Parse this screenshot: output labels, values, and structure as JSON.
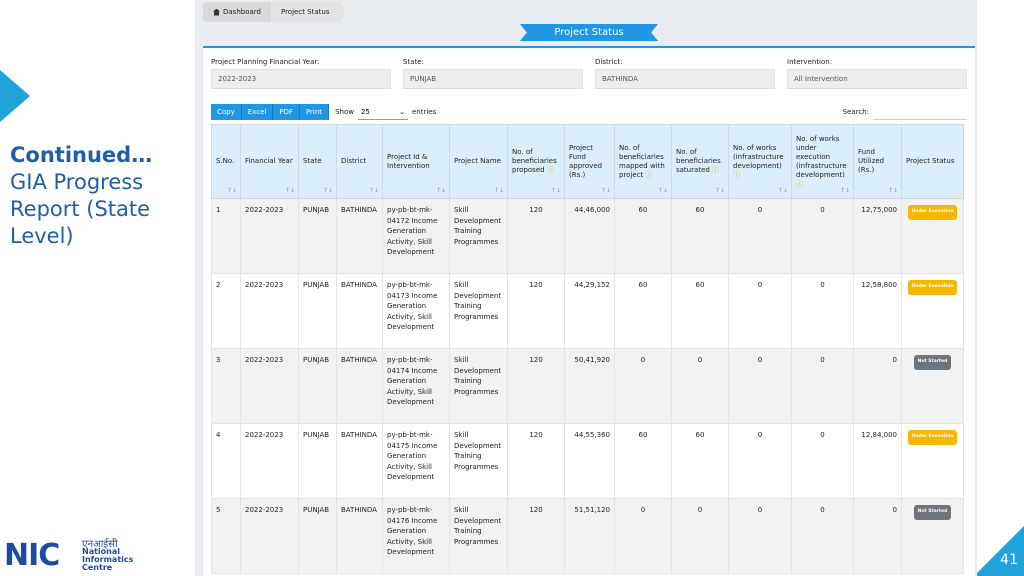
{
  "slide": {
    "title_bold": "Continued…",
    "title_rest": "GIA Progress Report (State Level)",
    "page_number": "41",
    "logo": {
      "mark": "NIC",
      "hindi": "एनआईसी",
      "line1": "National",
      "line2": "Informatics",
      "line3": "Centre"
    }
  },
  "breadcrumb": {
    "home": "Dashboard",
    "current": "Project Status"
  },
  "ribbon_title": "Project Status",
  "filters": [
    {
      "label": "Project Planning Financial Year:",
      "value": "2022-2023"
    },
    {
      "label": "State:",
      "value": "PUNJAB"
    },
    {
      "label": "District:",
      "value": "BATHINDA"
    },
    {
      "label": "Intervention:",
      "value": "All Intervention"
    }
  ],
  "toolbar": {
    "buttons": [
      "Copy",
      "Excel",
      "PDF",
      "Print"
    ],
    "show_label": "Show",
    "show_value": "25",
    "entries_label": "entries",
    "search_label": "Search:"
  },
  "colors": {
    "accent": "#2196e3",
    "under_execution": "#f5b700",
    "not_started": "#6c757d",
    "link": "#1a3fb5"
  },
  "table": {
    "headers": [
      "S.No.",
      "Financial Year",
      "State",
      "District",
      "Project Id & Intervention",
      "Project Name",
      "No. of beneficiaries proposed",
      "Project Fund approved (Rs.)",
      "No. of beneficiaries mapped with project",
      "No. of beneficiaries saturated",
      "No. of works (infrastructure development)",
      "No. of works under execution (infrastructure development)",
      "Fund Utilized (Rs.)",
      "Project Status"
    ],
    "rows": [
      {
        "sno": "1",
        "year": "2022-2023",
        "state": "PUNJAB",
        "district": "BATHINDA",
        "project_id": "py-pb-bt-mk-04172 Income Generation Activity, Skill Development",
        "name": "Skill Development Training Programmes",
        "proposed": "120",
        "fund": "44,46,000",
        "mapped": "60",
        "saturated": "60",
        "works": "0",
        "works_exec": "0",
        "utilized": "12,75,000",
        "status": "Under Execution",
        "status_type": "under"
      },
      {
        "sno": "2",
        "year": "2022-2023",
        "state": "PUNJAB",
        "district": "BATHINDA",
        "project_id": "py-pb-bt-mk-04173 Income Generation Activity, Skill Development",
        "name": "Skill Development Training Programmes",
        "proposed": "120",
        "fund": "44,29,152",
        "mapped": "60",
        "saturated": "60",
        "works": "0",
        "works_exec": "0",
        "utilized": "12,58,800",
        "status": "Under Execution",
        "status_type": "under"
      },
      {
        "sno": "3",
        "year": "2022-2023",
        "state": "PUNJAB",
        "district": "BATHINDA",
        "project_id": "py-pb-bt-mk-04174 Income Generation Activity, Skill Development",
        "name": "Skill Development Training Programmes",
        "proposed": "120",
        "fund": "50,41,920",
        "mapped": "0",
        "saturated": "0",
        "works": "0",
        "works_exec": "0",
        "utilized": "0",
        "status": "Not Started",
        "status_type": "not"
      },
      {
        "sno": "4",
        "year": "2022-2023",
        "state": "PUNJAB",
        "district": "BATHINDA",
        "project_id": "py-pb-bt-mk-04175 Income Generation Activity, Skill Development",
        "name": "Skill Development Training Programmes",
        "proposed": "120",
        "fund": "44,55,360",
        "mapped": "60",
        "saturated": "60",
        "works": "0",
        "works_exec": "0",
        "utilized": "12,84,000",
        "status": "Under Execution",
        "status_type": "under"
      },
      {
        "sno": "5",
        "year": "2022-2023",
        "state": "PUNJAB",
        "district": "BATHINDA",
        "project_id": "py-pb-bt-mk-04176 Income Generation Activity, Skill Development",
        "name": "Skill Development Training Programmes",
        "proposed": "120",
        "fund": "51,51,120",
        "mapped": "0",
        "saturated": "0",
        "works": "0",
        "works_exec": "0",
        "utilized": "0",
        "status": "Not Started",
        "status_type": "not"
      }
    ]
  }
}
